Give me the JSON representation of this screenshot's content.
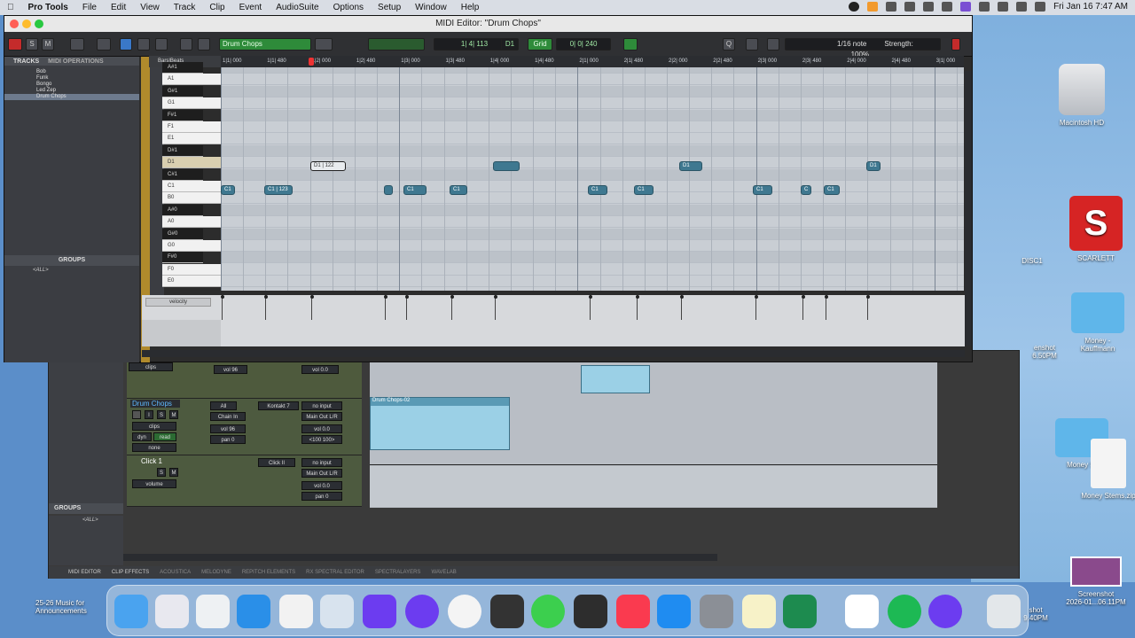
{
  "menubar": {
    "app": "Pro Tools",
    "items": [
      "File",
      "Edit",
      "View",
      "Track",
      "Clip",
      "Event",
      "AudioSuite",
      "Options",
      "Setup",
      "Window",
      "Help"
    ],
    "datetime": "Fri Jan 16  7:47 AM"
  },
  "desktop": {
    "hd": "Macintosh HD",
    "scarlett": "SCARLETT",
    "disc": "DISC1",
    "money_folder": "Money -\nKauffmann",
    "money_stems": "Money St",
    "money_zip": "Money Stems.zip",
    "screenshot1": "enshot\n6.50PM",
    "screenshot2": "Screenshot\n2026-01...06.11PM",
    "screenshot3": "shot\n9.40PM",
    "music": "25-26 Music for\nAnnouncements"
  },
  "midi_editor": {
    "title": "MIDI Editor: \"Drum Chops\"",
    "track_selector": "Drum Chops",
    "counter_main": "1| 4| 113",
    "note_label": "D1",
    "grid_label": "Grid",
    "grid_value": "0| 0| 240",
    "note_value": "1/16 note",
    "strength_label": "Strength:",
    "strength_value": "100%",
    "side_tabs": {
      "tracks": "TRACKS",
      "midi_ops": "MIDI OPERATIONS"
    },
    "tracks": [
      "Bob",
      "Funk",
      "Bongo",
      "Led Zep",
      "Drum Chops"
    ],
    "groups_title": "GROUPS",
    "groups_all": "<ALL>",
    "ruler_label": "Bars|Beats",
    "ruler_ticks": [
      "1|1| 000",
      "1|1| 480",
      "1|2| 000",
      "1|2| 480",
      "1|3| 000",
      "1|3| 480",
      "1|4| 000",
      "1|4| 480",
      "2|1| 000",
      "2|1| 480",
      "2|2| 000",
      "2|2| 480",
      "2|3| 000",
      "2|3| 480",
      "2|4| 000",
      "2|4| 480",
      "3|1| 000"
    ],
    "keys": [
      "A#1",
      "A1",
      "G#1",
      "G1",
      "F#1",
      "F1",
      "E1",
      "D#1",
      "D1",
      "C#1",
      "C1",
      "B0",
      "A#0",
      "A0",
      "G#0",
      "G0",
      "F#0",
      "F0",
      "E0"
    ],
    "notes_d1": [
      "D1 | 122",
      "",
      "D1",
      "D1"
    ],
    "notes_c1": [
      "C1",
      "C1 | 123",
      "",
      "C1",
      "C1",
      "C1",
      "C1",
      "C1",
      "C",
      "C1"
    ],
    "velocity_label": "velocity"
  },
  "edit_window": {
    "track1": {
      "name": "Drum Chops",
      "vol": "vol 96",
      "pan": "pan 0",
      "input": "no input",
      "output": "Main Out L/R",
      "insert": "Kontakt 7",
      "chain": "Chain In",
      "all": "All",
      "clips": "clips",
      "dyn": "dyn",
      "read": "read",
      "none": "none",
      "v1": "vol 0.0",
      "p1": "<100  100>"
    },
    "track2": {
      "name": "Click 1",
      "insert": "Click II",
      "input": "no input",
      "output": "Main Out L/R",
      "volume": "volume",
      "vol": "vol 0.0",
      "pan": "pan 0"
    },
    "clip_name": "Drum Chops-02",
    "groups_title": "GROUPS",
    "groups_all": "<ALL>",
    "bottom_tabs": [
      "MIDI EDITOR",
      "CLIP EFFECTS",
      "ACOUSTICA",
      "MELODYNE",
      "REPITCH ELEMENTS",
      "RX SPECTRAL EDITOR",
      "SPECTRALAYERS",
      "WAVELAB"
    ]
  },
  "colors": {
    "note": "#3f7890",
    "clip": "#9bd0e6",
    "accent_green": "#2e8b3a",
    "record_red": "#c42b2b"
  }
}
